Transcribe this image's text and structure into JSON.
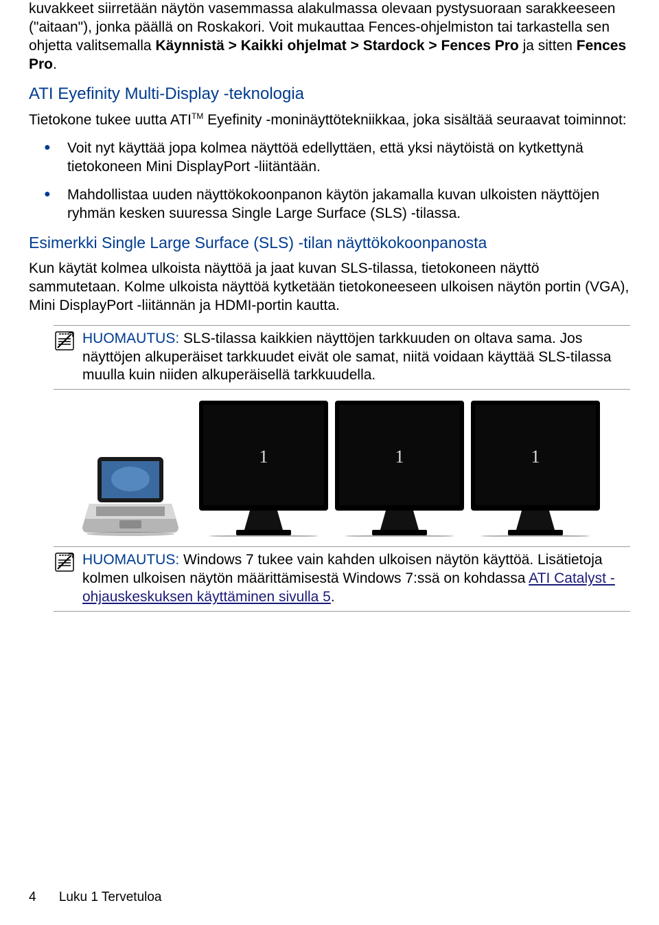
{
  "intro_p1": "kuvakkeet siirretään näytön vasemmassa alakulmassa olevaan pystysuoraan sarakkeeseen (\"aitaan\"), jonka päällä on Roskakori. Voit mukauttaa Fences-ohjelmiston tai tarkastella sen ohjetta valitsemalla ",
  "intro_p1_bold1": "Käynnistä > Kaikki ohjelmat > Stardock > Fences Pro",
  "intro_p1_mid": " ja sitten ",
  "intro_p1_bold2": "Fences Pro",
  "intro_p1_end": ".",
  "heading1": "ATI Eyefinity Multi-Display -teknologia",
  "tech_p1a": "Tietokone tukee uutta ATI",
  "tm": "TM",
  "tech_p1b": " Eyefinity -moninäyttötekniikkaa, joka sisältää seuraavat toiminnot:",
  "bullets": {
    "b1": "Voit nyt käyttää jopa kolmea näyttöä edellyttäen, että yksi näytöistä on kytkettynä tietokoneen Mini DisplayPort -liitäntään.",
    "b2": "Mahdollistaa uuden näyttökokoonpanon käytön jakamalla kuvan ulkoisten näyttöjen ryhmän kesken suuressa Single Large Surface (SLS) -tilassa."
  },
  "heading2": "Esimerkki Single Large Surface (SLS) -tilan näyttökokoonpanosta",
  "sls_p1": "Kun käytät kolmea ulkoista näyttöä ja jaat kuvan SLS-tilassa, tietokoneen näyttö sammutetaan. Kolme ulkoista näyttöä kytketään tietokoneeseen ulkoisen näytön portin (VGA), Mini DisplayPort -liitännän ja HDMI-portin kautta.",
  "note1_label": "HUOMAUTUS:",
  "note1_text": "    SLS-tilassa kaikkien näyttöjen tarkkuuden on oltava sama. Jos näyttöjen alkuperäiset tarkkuudet eivät ole samat, niitä voidaan käyttää SLS-tilassa muulla kuin niiden alkuperäisellä tarkkuudella.",
  "monitor_label": "1",
  "note2_label": "HUOMAUTUS:",
  "note2_text_a": "    Windows 7 tukee vain kahden ulkoisen näytön käyttöä. Lisätietoja kolmen ulkoisen näytön määrittämisestä Windows 7:ssä on kohdassa ",
  "note2_link_text": "ATI Catalyst -ohjauskeskuksen käyttäminen sivulla 5",
  "note2_text_b": ".",
  "footer_page": "4",
  "footer_chapter": "Luku 1   Tervetuloa"
}
